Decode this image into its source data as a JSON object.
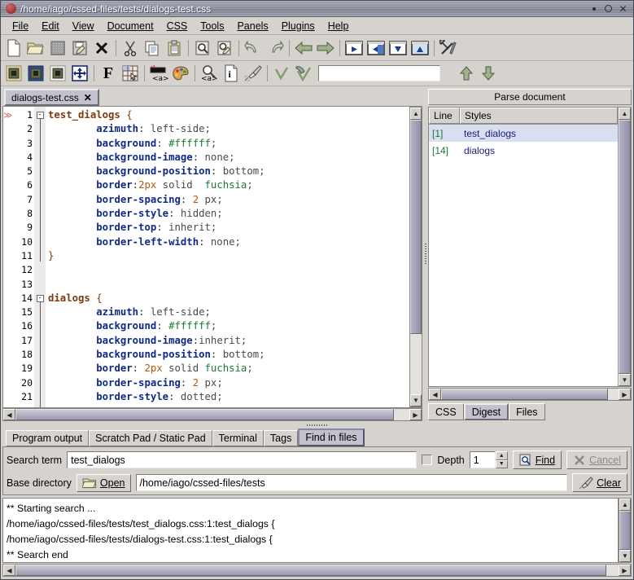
{
  "window": {
    "title": "/home/iago/cssed-files/tests/dialogs-test.css",
    "icon": "app-icon",
    "buttons": {
      "minimize": "minimize-icon",
      "maximize": "maximize-icon",
      "close": "✕"
    }
  },
  "menubar": {
    "items": [
      {
        "label": "File"
      },
      {
        "label": "Edit"
      },
      {
        "label": "View"
      },
      {
        "label": "Document"
      },
      {
        "label": "CSS"
      },
      {
        "label": "Tools"
      },
      {
        "label": "Panels"
      },
      {
        "label": "Plugins"
      },
      {
        "label": "Help"
      }
    ]
  },
  "toolbar_main": {
    "items": [
      {
        "name": "new-file-icon"
      },
      {
        "name": "open-folder-icon"
      },
      {
        "name": "save-icon"
      },
      {
        "name": "save-as-icon"
      },
      {
        "name": "close-file-icon"
      },
      {
        "sep": true
      },
      {
        "name": "cut-icon"
      },
      {
        "name": "copy-icon"
      },
      {
        "name": "paste-icon"
      },
      {
        "sep": true
      },
      {
        "name": "find-icon"
      },
      {
        "name": "find-replace-icon"
      },
      {
        "sep": true
      },
      {
        "name": "undo-icon"
      },
      {
        "name": "redo-icon"
      },
      {
        "sep": true
      },
      {
        "name": "back-icon"
      },
      {
        "name": "forward-icon"
      },
      {
        "sep": true
      },
      {
        "name": "panel-right-icon"
      },
      {
        "name": "panel-left-icon"
      },
      {
        "name": "panel-bottom-icon"
      },
      {
        "name": "panel-top-icon"
      },
      {
        "sep": true
      },
      {
        "name": "preferences-icon"
      }
    ]
  },
  "toolbar_css": {
    "items": [
      {
        "name": "css-box-gold-icon"
      },
      {
        "name": "css-box-blue-icon"
      },
      {
        "name": "css-box-white-icon"
      },
      {
        "name": "css-position-icon"
      },
      {
        "sep": true
      },
      {
        "name": "font-icon"
      },
      {
        "name": "table-icon"
      },
      {
        "sep": true
      },
      {
        "name": "anchor-style-icon"
      },
      {
        "name": "color-palette-icon"
      },
      {
        "sep": true
      },
      {
        "name": "anchor-zoom-icon"
      },
      {
        "name": "info-icon"
      },
      {
        "name": "brush-icon"
      },
      {
        "sep": true
      },
      {
        "name": "validate-icon"
      },
      {
        "name": "validate-doc-icon"
      }
    ],
    "field_value": "",
    "up_icon": "arrow-up-icon",
    "down_icon": "arrow-down-icon"
  },
  "editor": {
    "tab": {
      "label": "dialogs-test.css",
      "close": "✕"
    },
    "lines": [
      {
        "n": 1,
        "marker": "≫",
        "fold": "-",
        "tokens": [
          {
            "t": "test_dialogs",
            "c": "sel"
          },
          {
            "t": " ",
            "c": "punc"
          },
          {
            "t": "{",
            "c": "brace"
          }
        ]
      },
      {
        "n": 2,
        "tokens": [
          {
            "t": "        ",
            "c": "punc"
          },
          {
            "t": "azimuth",
            "c": "prop"
          },
          {
            "t": ": ",
            "c": "punc"
          },
          {
            "t": "left-side;",
            "c": "val"
          }
        ]
      },
      {
        "n": 3,
        "tokens": [
          {
            "t": "        ",
            "c": "punc"
          },
          {
            "t": "background",
            "c": "prop"
          },
          {
            "t": ": ",
            "c": "punc"
          },
          {
            "t": "#ffffff",
            "c": "kw"
          },
          {
            "t": ";",
            "c": "val"
          }
        ]
      },
      {
        "n": 4,
        "tokens": [
          {
            "t": "        ",
            "c": "punc"
          },
          {
            "t": "background-image",
            "c": "prop"
          },
          {
            "t": ": ",
            "c": "punc"
          },
          {
            "t": "none;",
            "c": "val"
          }
        ]
      },
      {
        "n": 5,
        "tokens": [
          {
            "t": "        ",
            "c": "punc"
          },
          {
            "t": "background-position",
            "c": "prop"
          },
          {
            "t": ": ",
            "c": "punc"
          },
          {
            "t": "bottom;",
            "c": "val"
          }
        ]
      },
      {
        "n": 6,
        "tokens": [
          {
            "t": "        ",
            "c": "punc"
          },
          {
            "t": "border",
            "c": "prop"
          },
          {
            "t": ":",
            "c": "punc"
          },
          {
            "t": "2px",
            "c": "num"
          },
          {
            "t": " solid  ",
            "c": "val"
          },
          {
            "t": "fuchsia",
            "c": "kw"
          },
          {
            "t": ";",
            "c": "val"
          }
        ]
      },
      {
        "n": 7,
        "tokens": [
          {
            "t": "        ",
            "c": "punc"
          },
          {
            "t": "border-spacing",
            "c": "prop"
          },
          {
            "t": ": ",
            "c": "punc"
          },
          {
            "t": "2",
            "c": "num"
          },
          {
            "t": " px;",
            "c": "val"
          }
        ]
      },
      {
        "n": 8,
        "tokens": [
          {
            "t": "        ",
            "c": "punc"
          },
          {
            "t": "border-style",
            "c": "prop"
          },
          {
            "t": ": ",
            "c": "punc"
          },
          {
            "t": "hidden;",
            "c": "val"
          }
        ]
      },
      {
        "n": 9,
        "tokens": [
          {
            "t": "        ",
            "c": "punc"
          },
          {
            "t": "border-top",
            "c": "prop"
          },
          {
            "t": ": ",
            "c": "punc"
          },
          {
            "t": "inherit;",
            "c": "val"
          }
        ]
      },
      {
        "n": 10,
        "tokens": [
          {
            "t": "        ",
            "c": "punc"
          },
          {
            "t": "border-left-width",
            "c": "prop"
          },
          {
            "t": ": ",
            "c": "punc"
          },
          {
            "t": "none;",
            "c": "val"
          }
        ]
      },
      {
        "n": 11,
        "tokens": [
          {
            "t": "}",
            "c": "brace"
          }
        ]
      },
      {
        "n": 12,
        "tokens": []
      },
      {
        "n": 13,
        "tokens": []
      },
      {
        "n": 14,
        "fold": "-",
        "tokens": [
          {
            "t": "dialogs",
            "c": "sel"
          },
          {
            "t": " ",
            "c": "punc"
          },
          {
            "t": "{",
            "c": "brace"
          }
        ]
      },
      {
        "n": 15,
        "tokens": [
          {
            "t": "        ",
            "c": "punc"
          },
          {
            "t": "azimuth",
            "c": "prop"
          },
          {
            "t": ": ",
            "c": "punc"
          },
          {
            "t": "left-side;",
            "c": "val"
          }
        ]
      },
      {
        "n": 16,
        "tokens": [
          {
            "t": "        ",
            "c": "punc"
          },
          {
            "t": "background",
            "c": "prop"
          },
          {
            "t": ": ",
            "c": "punc"
          },
          {
            "t": "#ffffff",
            "c": "kw"
          },
          {
            "t": ";",
            "c": "val"
          }
        ]
      },
      {
        "n": 17,
        "tokens": [
          {
            "t": "        ",
            "c": "punc"
          },
          {
            "t": "background-image",
            "c": "prop"
          },
          {
            "t": ":",
            "c": "punc"
          },
          {
            "t": "inherit;",
            "c": "val"
          }
        ]
      },
      {
        "n": 18,
        "tokens": [
          {
            "t": "        ",
            "c": "punc"
          },
          {
            "t": "background-position",
            "c": "prop"
          },
          {
            "t": ": ",
            "c": "punc"
          },
          {
            "t": "bottom;",
            "c": "val"
          }
        ]
      },
      {
        "n": 19,
        "tokens": [
          {
            "t": "        ",
            "c": "punc"
          },
          {
            "t": "border",
            "c": "prop"
          },
          {
            "t": ": ",
            "c": "punc"
          },
          {
            "t": "2px",
            "c": "num"
          },
          {
            "t": " solid ",
            "c": "val"
          },
          {
            "t": "fuchsia",
            "c": "kw"
          },
          {
            "t": ";",
            "c": "val"
          }
        ]
      },
      {
        "n": 20,
        "tokens": [
          {
            "t": "        ",
            "c": "punc"
          },
          {
            "t": "border-spacing",
            "c": "prop"
          },
          {
            "t": ": ",
            "c": "punc"
          },
          {
            "t": "2",
            "c": "num"
          },
          {
            "t": " px;",
            "c": "val"
          }
        ]
      },
      {
        "n": 21,
        "tokens": [
          {
            "t": "        ",
            "c": "punc"
          },
          {
            "t": "border-style",
            "c": "prop"
          },
          {
            "t": ": ",
            "c": "punc"
          },
          {
            "t": "dotted;",
            "c": "val"
          }
        ]
      }
    ]
  },
  "parse_panel": {
    "title": "Parse document",
    "columns": [
      "Line",
      "Styles"
    ],
    "rows": [
      {
        "line": "[1]",
        "style": "test_dialogs",
        "selected": true
      },
      {
        "line": "[14]",
        "style": "dialogs",
        "selected": false
      }
    ],
    "tabs": [
      {
        "label": "CSS",
        "active": false
      },
      {
        "label": "Digest",
        "active": true
      },
      {
        "label": "Files",
        "active": false
      }
    ]
  },
  "bottom_panel": {
    "tabs": [
      {
        "label": "Program output",
        "active": false
      },
      {
        "label": "Scratch Pad / Static Pad",
        "active": false
      },
      {
        "label": "Terminal",
        "active": false
      },
      {
        "label": "Tags",
        "active": false
      },
      {
        "label": "Find in files",
        "active": true
      }
    ],
    "search_term_label": "Search term",
    "search_term_value": "test_dialogs",
    "depth_label": "Depth",
    "depth_checked": false,
    "depth_value": "1",
    "find_label": "Find",
    "find_icon": "find-icon",
    "cancel_label": "Cancel",
    "cancel_icon": "cancel-icon",
    "cancel_disabled": true,
    "base_dir_label": "Base directory",
    "open_label": "Open",
    "open_icon": "open-folder-icon",
    "base_dir_value": "/home/iago/cssed-files/tests",
    "clear_label": "Clear",
    "clear_icon": "brush-icon",
    "output_lines": [
      "** Starting search ...",
      "/home/iago/cssed-files/tests/test_dialogs.css:1:test_dialogs {",
      "/home/iago/cssed-files/tests/dialogs-test.css:1:test_dialogs {",
      "** Search end"
    ]
  },
  "colors": {
    "chrome": "#d6d3ce",
    "titlebar": "#8f91a2",
    "selector": "#7a3b10",
    "property": "#0f2a86",
    "value": "#4a4a4a",
    "number": "#b4590a",
    "keyword": "#1c7a36",
    "tree_line": "#1c7a36",
    "tree_style": "#1a1a7a",
    "selected_row": "#d8dff0"
  }
}
